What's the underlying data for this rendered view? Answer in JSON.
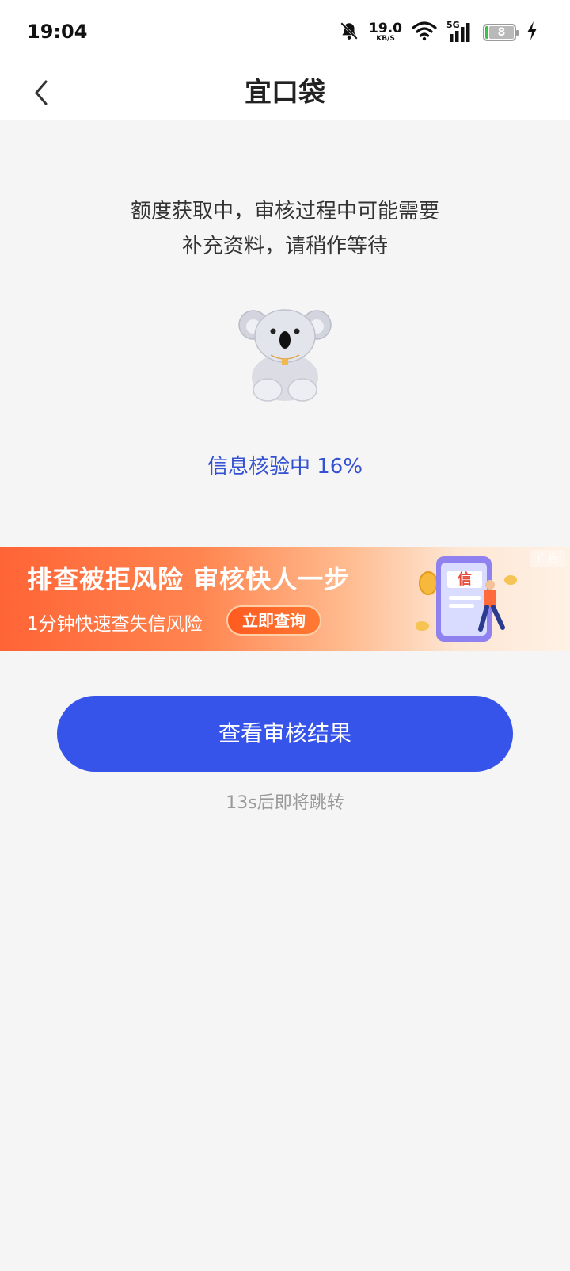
{
  "status_bar": {
    "time": "19:04",
    "speed_value": "19.0",
    "speed_unit": "KB/S",
    "network": "5G",
    "battery_level": "8",
    "icons": [
      "bell-off-icon",
      "wifi-icon",
      "signal-icon",
      "battery-icon",
      "charging-icon"
    ]
  },
  "header": {
    "title": "宜口袋",
    "back_icon": "chevron-left-icon"
  },
  "main": {
    "message_line1": "额度获取中，审核过程中可能需要",
    "message_line2": "补充资料，请稍作等待",
    "mascot": "koala-illustration",
    "progress_text": "信息核验中 16%",
    "progress_percent": 16,
    "progress_color": "#3451d1"
  },
  "ad_banner": {
    "title": "排查被拒风险  审核快人一步",
    "subtitle": "1分钟快速查失信风险",
    "button_label": "立即查询",
    "tag": "广告",
    "illustration_char": "信"
  },
  "actions": {
    "primary_button": "查看审核结果",
    "primary_color": "#3653ea",
    "countdown_text": "13s后即将跳转"
  }
}
